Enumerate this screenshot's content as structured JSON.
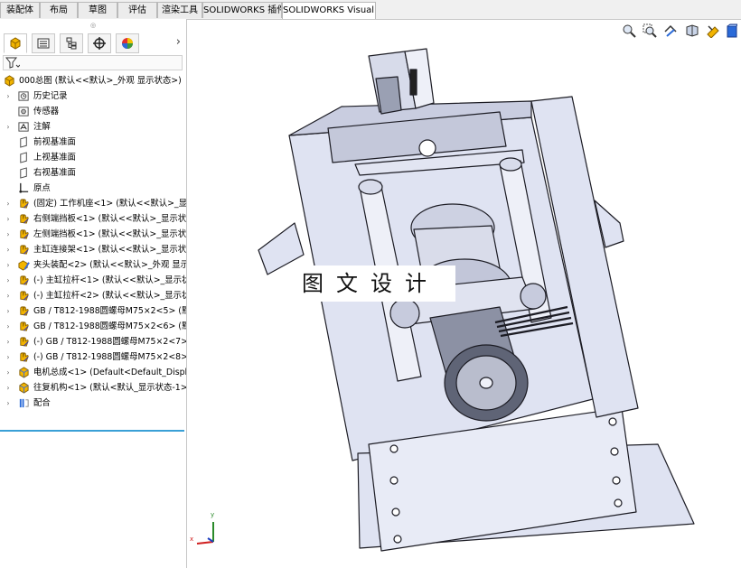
{
  "tabs": [
    {
      "label": "装配体",
      "active": false
    },
    {
      "label": "布局",
      "active": false
    },
    {
      "label": "草图",
      "active": false
    },
    {
      "label": "评估",
      "active": false
    },
    {
      "label": "渲染工具",
      "active": false
    },
    {
      "label": "SOLIDWORKS 插件",
      "active": false
    },
    {
      "label": "SOLIDWORKS Visualize",
      "active": true
    }
  ],
  "panel": {
    "tab_icons": [
      "feature-manager-icon",
      "property-manager-icon",
      "configuration-manager-icon",
      "dimxpert-icon",
      "display-manager-icon"
    ],
    "more_glyph": "›",
    "filter_icon": "filter-icon",
    "root": {
      "label": "000总图 (默认<<默认>_外观 显示状态>)",
      "icon": "assembly-icon"
    },
    "items": [
      {
        "label": "历史记录",
        "icon": "history-icon",
        "caret": true
      },
      {
        "label": "传感器",
        "icon": "sensor-icon",
        "caret": false
      },
      {
        "label": "注解",
        "icon": "annotation-icon",
        "caret": true
      },
      {
        "label": "前视基准面",
        "icon": "plane-icon",
        "caret": false
      },
      {
        "label": "上视基准面",
        "icon": "plane-icon",
        "caret": false
      },
      {
        "label": "右视基准面",
        "icon": "plane-icon",
        "caret": false
      },
      {
        "label": "原点",
        "icon": "origin-icon",
        "caret": false
      },
      {
        "label": "(固定) 工作机座<1> (默认<<默认>_显示",
        "icon": "part-icon",
        "caret": true
      },
      {
        "label": "右侧端挡板<1> (默认<<默认>_显示状",
        "icon": "part-icon",
        "caret": true
      },
      {
        "label": "左侧端挡板<1> (默认<<默认>_显示状",
        "icon": "part-icon",
        "caret": true
      },
      {
        "label": "主缸连接架<1> (默认<<默认>_显示状",
        "icon": "part-icon",
        "caret": true
      },
      {
        "label": "夹头装配<2> (默认<<默认>_外观 显示",
        "icon": "subassembly-edit-icon",
        "caret": true
      },
      {
        "label": "(-) 主缸拉杆<1> (默认<<默认>_显示状",
        "icon": "part-icon",
        "caret": true
      },
      {
        "label": "(-) 主缸拉杆<2> (默认<<默认>_显示状",
        "icon": "part-icon",
        "caret": true
      },
      {
        "label": "GB / T812-1988圆螺母M75×2<5> (默",
        "icon": "part-icon",
        "caret": true
      },
      {
        "label": "GB / T812-1988圆螺母M75×2<6> (默",
        "icon": "part-icon",
        "caret": true
      },
      {
        "label": "(-) GB / T812-1988圆螺母M75×2<7>",
        "icon": "part-icon",
        "caret": true
      },
      {
        "label": "(-) GB / T812-1988圆螺母M75×2<8>",
        "icon": "part-icon",
        "caret": true
      },
      {
        "label": "电机总成<1> (Default<Default_Displa",
        "icon": "subassembly-icon",
        "caret": true
      },
      {
        "label": "往复机构<1> (默认<默认_显示状态-1>)",
        "icon": "subassembly-icon",
        "caret": true
      },
      {
        "label": "配合",
        "icon": "mates-icon",
        "caret": true
      }
    ]
  },
  "viewport": {
    "heads_up_icons": [
      "zoom-to-fit-icon",
      "zoom-to-area-icon",
      "previous-view-icon",
      "section-view-icon",
      "view-orientation-icon",
      "display-style-icon"
    ],
    "watermark": "图文设计",
    "triad": {
      "x_label": "x",
      "y_label": "y"
    }
  },
  "colors": {
    "part": "#dfe3f2",
    "edge": "#1c1c24",
    "accent": "#3aa0d6",
    "yellow_icon": "#f2b400"
  }
}
